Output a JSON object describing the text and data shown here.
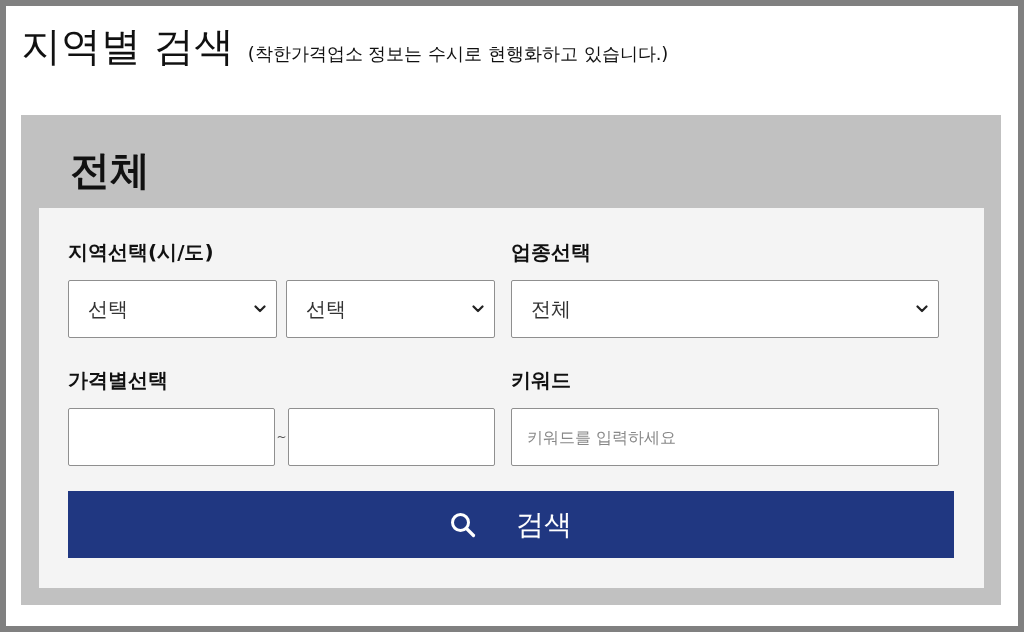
{
  "page": {
    "title": "지역별 검색",
    "notice": "(착한가격업소 정보는 수시로 현행화하고 있습니다.)"
  },
  "panel": {
    "heading": "전체",
    "fields": [
      {
        "kind": "select-pair",
        "label": "지역선택(시/도)",
        "selects": [
          {
            "value": "선택"
          },
          {
            "value": "선택"
          }
        ]
      },
      {
        "kind": "select",
        "label": "업종선택",
        "value": "전체"
      },
      {
        "kind": "range",
        "label": "가격별선택",
        "separator": "~"
      },
      {
        "kind": "text",
        "label": "키워드",
        "placeholder": "키워드를 입력하세요"
      }
    ],
    "search_button": {
      "label": "검색"
    }
  }
}
